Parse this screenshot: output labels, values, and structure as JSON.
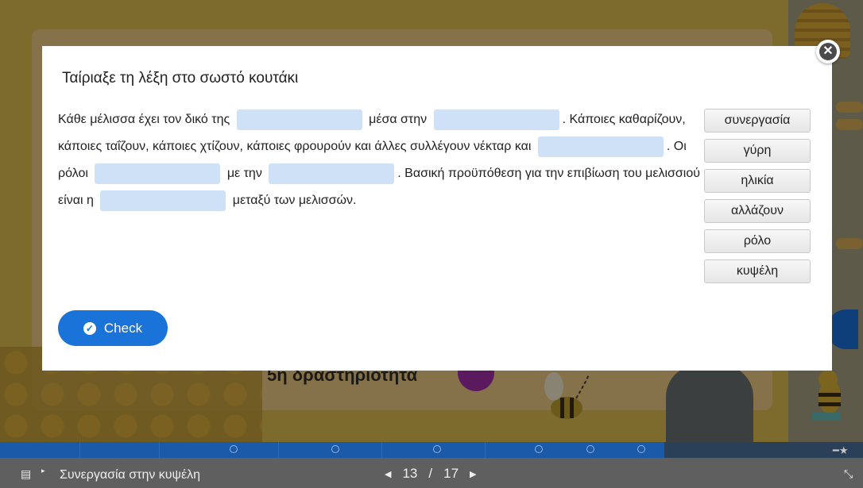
{
  "modal": {
    "title": "Ταίριαξε τη λέξη στο σωστό κουτάκι",
    "text_segments": {
      "s1": "Κάθε μέλισσα έχει τον δικό της",
      "s2": "μέσα στην",
      "s3": ". Κάποιες καθαρίζουν, κάποιες ταΐζουν, κάποιες χτίζουν, κάποιες φρουρούν και άλλες συλλέγουν νέκταρ και",
      "s4": ". Οι ρόλοι",
      "s5": "με την",
      "s6": ". Βασική προϋπόθεση για την επιβίωση του μελισσιού είναι η",
      "s7": "μεταξύ των μελισσών."
    },
    "word_bank": [
      "συνεργασία",
      "γύρη",
      "ηλικία",
      "αλλάζουν",
      "ρόλο",
      "κυψέλη"
    ],
    "check_label": "Check",
    "close_icon": "close-icon"
  },
  "background": {
    "subtitle": "5η δραστηριότητα"
  },
  "progress": {
    "fill_fraction": 0.77
  },
  "footer": {
    "slide_title": "Συνεργασία στην κυψέλη",
    "current_page": "13",
    "separator": "/",
    "total_pages": "17",
    "prev_icon": "prev-triangle-icon",
    "next_icon": "next-triangle-icon"
  },
  "colors": {
    "accent": "#1a73d8",
    "blank": "#cfe1f7",
    "progress": "#1a5aa8"
  }
}
